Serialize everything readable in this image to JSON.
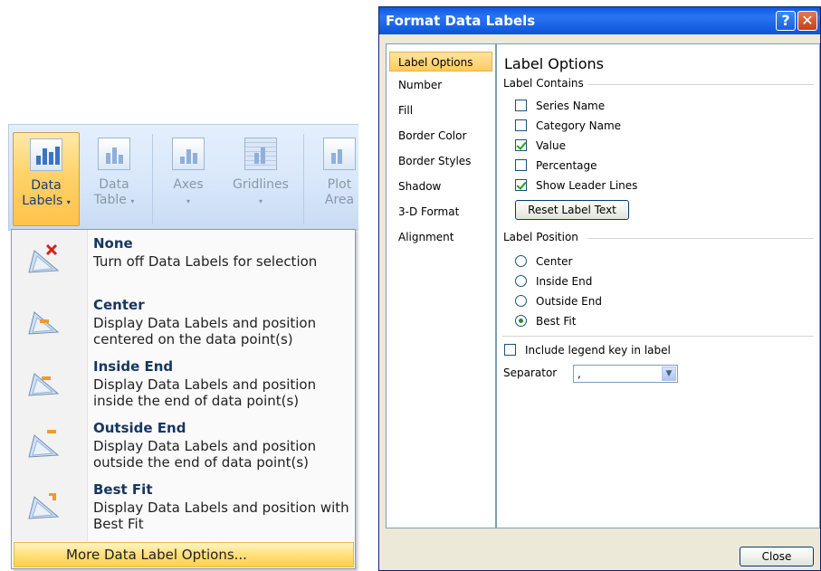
{
  "ribbon": {
    "buttons": [
      {
        "label_line1": "Data",
        "label_line2": "Labels",
        "has_arrow": true,
        "icon": "data-labels-icon",
        "active": true
      },
      {
        "label_line1": "Data",
        "label_line2": "Table",
        "has_arrow": true,
        "icon": "data-table-icon",
        "active": false
      },
      {
        "label_line1": "Axes",
        "label_line2": "",
        "has_arrow": true,
        "icon": "axes-icon",
        "active": false
      },
      {
        "label_line1": "Gridlines",
        "label_line2": "",
        "has_arrow": true,
        "icon": "gridlines-icon",
        "active": false
      },
      {
        "label_line1": "Plot",
        "label_line2": "Area",
        "has_arrow": false,
        "icon": "plot-area-icon",
        "active": false
      }
    ],
    "arrow": "▾"
  },
  "menu": {
    "items": [
      {
        "title": "None",
        "description": "Turn off Data Labels for selection",
        "icon": "no-labels-icon"
      },
      {
        "title": "Center",
        "description": "Display Data Labels and position centered on the data point(s)",
        "icon": "center-label-icon"
      },
      {
        "title": "Inside End",
        "description": "Display Data Labels and position inside the end of data point(s)",
        "icon": "inside-end-label-icon"
      },
      {
        "title": "Outside End",
        "description": "Display Data Labels and position outside the end of data point(s)",
        "icon": "outside-end-label-icon"
      },
      {
        "title": "Best Fit",
        "description": "Display Data Labels and position with Best Fit",
        "icon": "best-fit-label-icon"
      }
    ],
    "more_options": "More Data Label Options..."
  },
  "dialog": {
    "title": "Format Data Labels",
    "help_glyph": "?",
    "close_glyph": "✕",
    "nav": [
      "Label Options",
      "Number",
      "Fill",
      "Border Color",
      "Border Styles",
      "Shadow",
      "3-D Format",
      "Alignment"
    ],
    "selected_nav": "Label Options",
    "heading": "Label Options",
    "label_contains": {
      "title": "Label Contains",
      "options": [
        {
          "label": "Series Name",
          "checked": false
        },
        {
          "label": "Category Name",
          "checked": false
        },
        {
          "label": "Value",
          "checked": true
        },
        {
          "label": "Percentage",
          "checked": false
        },
        {
          "label": "Show Leader Lines",
          "checked": true
        }
      ],
      "reset_button": "Reset Label Text"
    },
    "label_position": {
      "title": "Label Position",
      "options": [
        {
          "label": "Center",
          "selected": false
        },
        {
          "label": "Inside End",
          "selected": false
        },
        {
          "label": "Outside End",
          "selected": false
        },
        {
          "label": "Best Fit",
          "selected": true
        }
      ]
    },
    "legend_key": {
      "label": "Include legend key in label",
      "checked": false
    },
    "separator": {
      "label": "Separator",
      "value": ","
    },
    "close_button": "Close"
  },
  "colors": {
    "titlebar": "#0a58e4",
    "selection": "#ffcb60",
    "dialog_face": "#ece9d8"
  }
}
